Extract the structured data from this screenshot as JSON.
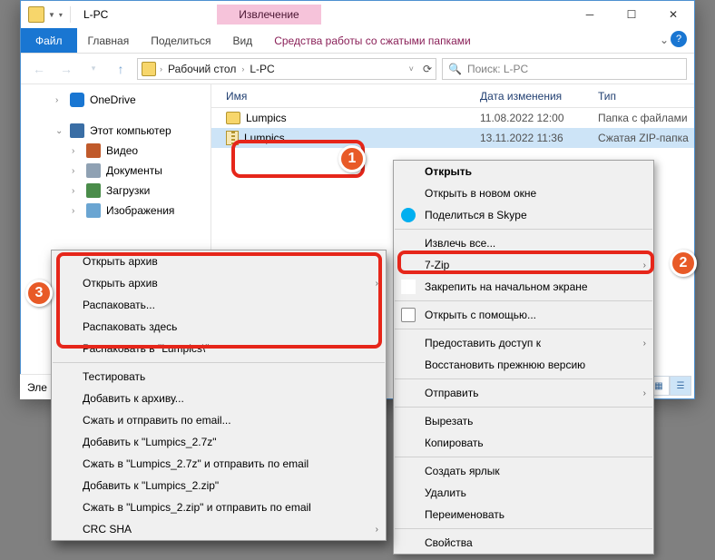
{
  "window": {
    "title": "L-PC",
    "extract_tab": "Извлечение",
    "ribbon": {
      "file": "Файл",
      "home": "Главная",
      "share": "Поделиться",
      "view": "Вид",
      "ctx_tools": "Средства работы со сжатыми папками"
    },
    "address": {
      "crumb1": "Рабочий стол",
      "crumb2": "L-PC"
    },
    "search_placeholder": "Поиск: L-PC"
  },
  "sidebar": {
    "onedrive": "OneDrive",
    "thispc": "Этот компьютер",
    "video": "Видео",
    "documents": "Документы",
    "downloads": "Загрузки",
    "images": "Изображения",
    "footer": "Эле"
  },
  "columns": {
    "name": "Имя",
    "date": "Дата изменения",
    "type": "Тип"
  },
  "files": [
    {
      "name": "Lumpics",
      "date": "11.08.2022 12:00",
      "type": "Папка с файлами",
      "kind": "folder"
    },
    {
      "name": "Lumpics",
      "date": "13.11.2022 11:36",
      "type": "Сжатая ZIP-папка",
      "kind": "zip"
    }
  ],
  "ctx_main": {
    "open": "Открыть",
    "open_new": "Открыть в новом окне",
    "skype": "Поделиться в Skype",
    "extract_all": "Извлечь все...",
    "sevenzip": "7-Zip",
    "pin_start": "Закрепить на начальном экране",
    "open_with": "Открыть с помощью...",
    "grant_access": "Предоставить доступ к",
    "restore": "Восстановить прежнюю версию",
    "send_to": "Отправить",
    "cut": "Вырезать",
    "copy": "Копировать",
    "shortcut": "Создать ярлык",
    "delete": "Удалить",
    "rename": "Переименовать",
    "properties": "Свойства"
  },
  "ctx_7zip": {
    "open_archive": "Открыть архив",
    "open_archive_sub": "Открыть архив",
    "unpack": "Распаковать...",
    "unpack_here": "Распаковать здесь",
    "unpack_to": "Распаковать в \"Lumpics\\\"",
    "test": "Тестировать",
    "add_to_archive": "Добавить к архиву...",
    "compress_email": "Сжать и отправить по email...",
    "add_7z": "Добавить к \"Lumpics_2.7z\"",
    "compress_7z_email": "Сжать в \"Lumpics_2.7z\" и отправить по email",
    "add_zip": "Добавить к \"Lumpics_2.zip\"",
    "compress_zip_email": "Сжать в \"Lumpics_2.zip\" и отправить по email",
    "crc_sha": "CRC SHA"
  },
  "badges": {
    "b1": "1",
    "b2": "2",
    "b3": "3"
  }
}
